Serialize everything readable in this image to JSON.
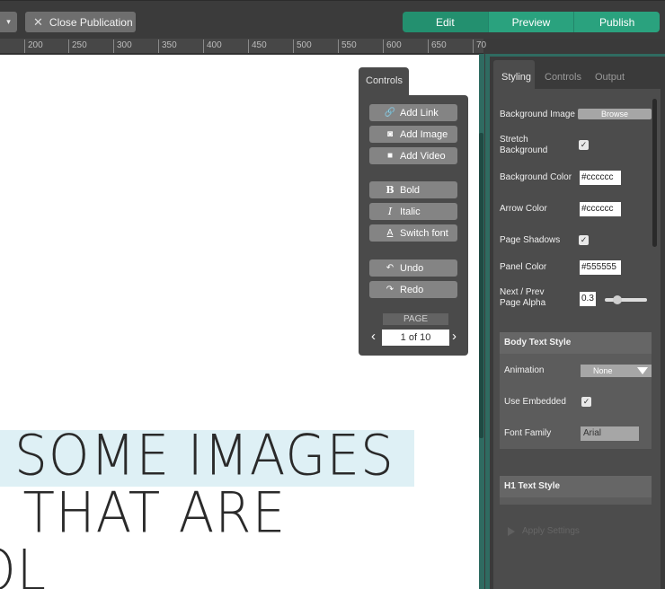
{
  "topbar": {
    "dropdown_glyph": "▾",
    "close_label": "Close Publication",
    "close_icon": "x-icon",
    "modes": [
      "Edit",
      "Preview",
      "Publish"
    ]
  },
  "ruler": {
    "ticks": [
      "200",
      "250",
      "300",
      "350",
      "400",
      "450",
      "500",
      "550",
      "600",
      "650",
      "70"
    ]
  },
  "canvas": {
    "lines": [
      "SOME IMAGES",
      "I THAT ARE",
      "OL"
    ],
    "highlight_color": "#def0f5"
  },
  "controls": {
    "tab": "Controls",
    "buttons": [
      {
        "icon": "link-icon",
        "label": "Add Link"
      },
      {
        "icon": "camera-icon",
        "label": "Add Image"
      },
      {
        "icon": "video-icon",
        "label": "Add Video"
      },
      {
        "icon": "bold-icon",
        "label": "Bold"
      },
      {
        "icon": "italic-icon",
        "label": "Italic"
      },
      {
        "icon": "font-icon",
        "label": "Switch font"
      },
      {
        "icon": "undo-icon",
        "label": "Undo"
      },
      {
        "icon": "redo-icon",
        "label": "Redo"
      }
    ],
    "page_label": "PAGE",
    "page_value": "1 of 10"
  },
  "right_panel": {
    "tabs": [
      "Styling",
      "Controls",
      "Output"
    ],
    "bg_image_label": "Background Image",
    "browse_label": "Browse",
    "stretch_label": "Stretch Background",
    "bg_color_label": "Background Color",
    "bg_color_value": "#cccccc",
    "arrow_color_label": "Arrow Color",
    "arrow_color_value": "#cccccc",
    "page_shadows_label": "Page Shadows",
    "panel_color_label": "Panel Color",
    "panel_color_value": "#555555",
    "alpha_label": "Next / Prev Page Alpha",
    "alpha_value": "0.3",
    "body_text_header": "Body Text Style",
    "animation_label": "Animation",
    "animation_value": "None",
    "use_embedded_label": "Use Embedded",
    "font_family_label": "Font Family",
    "font_family_value": "Arial",
    "h1_header": "H1 Text Style",
    "apply_label": "Apply Settings"
  },
  "colors": {
    "accent": "#2aa27e",
    "panel": "#4c4c4c"
  }
}
